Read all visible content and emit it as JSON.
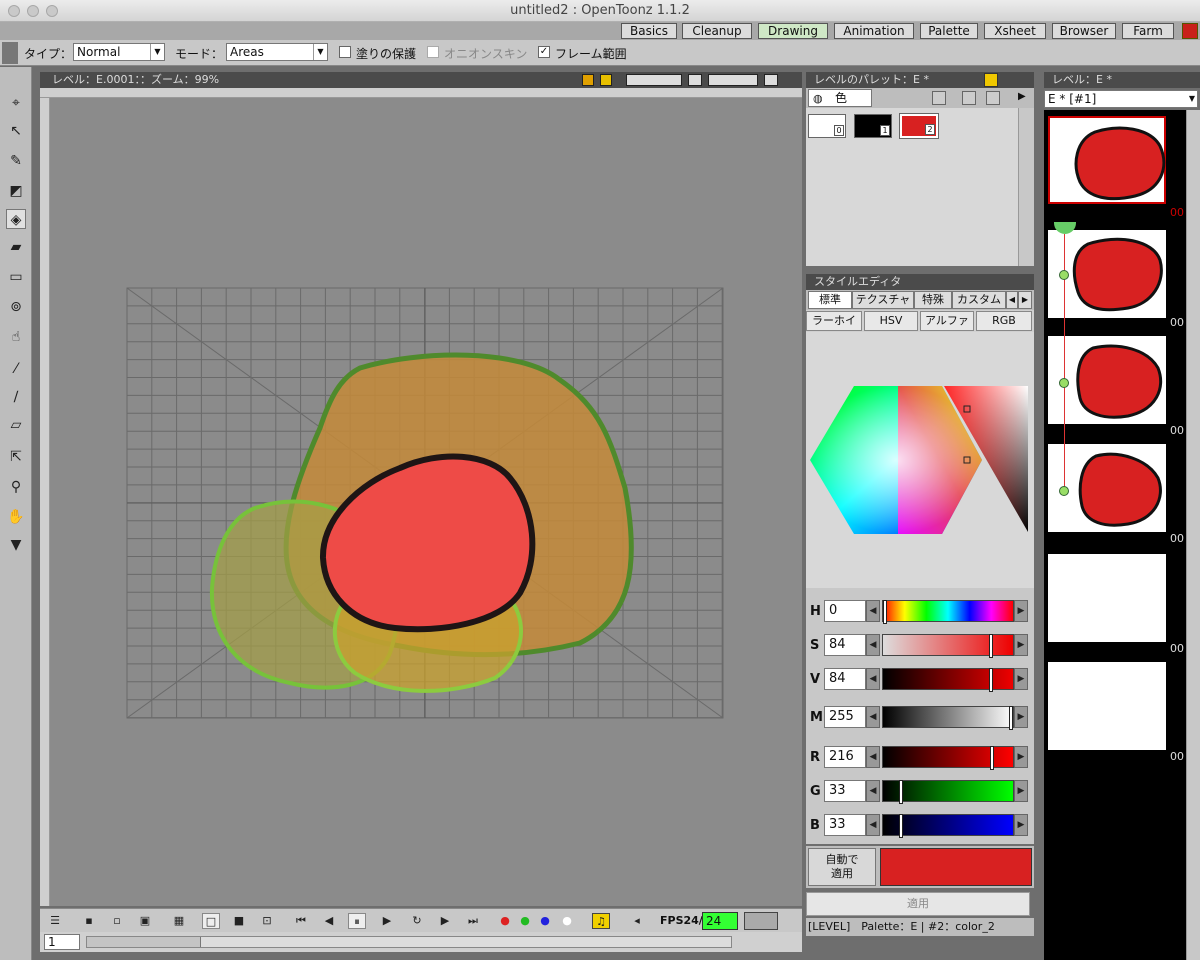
{
  "window": {
    "title": "untitled2 : OpenToonz 1.1.2"
  },
  "rooms": [
    "Basics",
    "Cleanup",
    "Drawing",
    "Animation",
    "Palette",
    "Xsheet",
    "Browser",
    "Farm"
  ],
  "active_room": "Drawing",
  "tool_options": {
    "type_label": "タイプ：",
    "type_value": "Normal",
    "mode_label": "モード：",
    "mode_value": "Areas",
    "checkbox_paint_protect": "塗りの保護",
    "checkbox_onion_skin": "オニオンスキン",
    "checkbox_frame_range": "フレーム範囲",
    "check_mark": "✓"
  },
  "viewer": {
    "header": "レベル：E.0001：：ズーム：99%"
  },
  "playback": {
    "fps_label": "FPS24/",
    "fps_value": "24",
    "frame_value": "1"
  },
  "palette": {
    "header": "レベルのパレット：E *",
    "tab_color": "色",
    "chips": [
      {
        "num": "0",
        "color": "#ffffff"
      },
      {
        "num": "1",
        "color": "#000000"
      },
      {
        "num": "2",
        "color": "#d82121"
      }
    ]
  },
  "style_editor": {
    "header": "スタイルエディタ",
    "tabs": [
      "標準",
      "テクスチャ",
      "特殊",
      "カスタム"
    ],
    "subtabs": [
      "ラーホイー",
      "HSV",
      "アルファ",
      "RGB"
    ],
    "sliders": [
      {
        "name": "H",
        "value": "0",
        "pos": 0
      },
      {
        "name": "S",
        "value": "84",
        "pos": 0.84
      },
      {
        "name": "V",
        "value": "84",
        "pos": 0.84
      },
      {
        "name": "M",
        "value": "255",
        "pos": 1.0
      },
      {
        "name": "R",
        "value": "216",
        "pos": 0.847
      },
      {
        "name": "G",
        "value": "33",
        "pos": 0.129
      },
      {
        "name": "B",
        "value": "33",
        "pos": 0.129
      }
    ],
    "auto_apply": "自動で\n適用",
    "current_color": "#d82121",
    "apply_label": "適用",
    "status": "[LEVEL]　Palette：E | #2：color_2"
  },
  "level_strip": {
    "header": "レベル：E *",
    "combo_value": "E * [#1]",
    "frame_numbers": [
      "00",
      "00",
      "00",
      "00",
      "00",
      "00"
    ]
  }
}
